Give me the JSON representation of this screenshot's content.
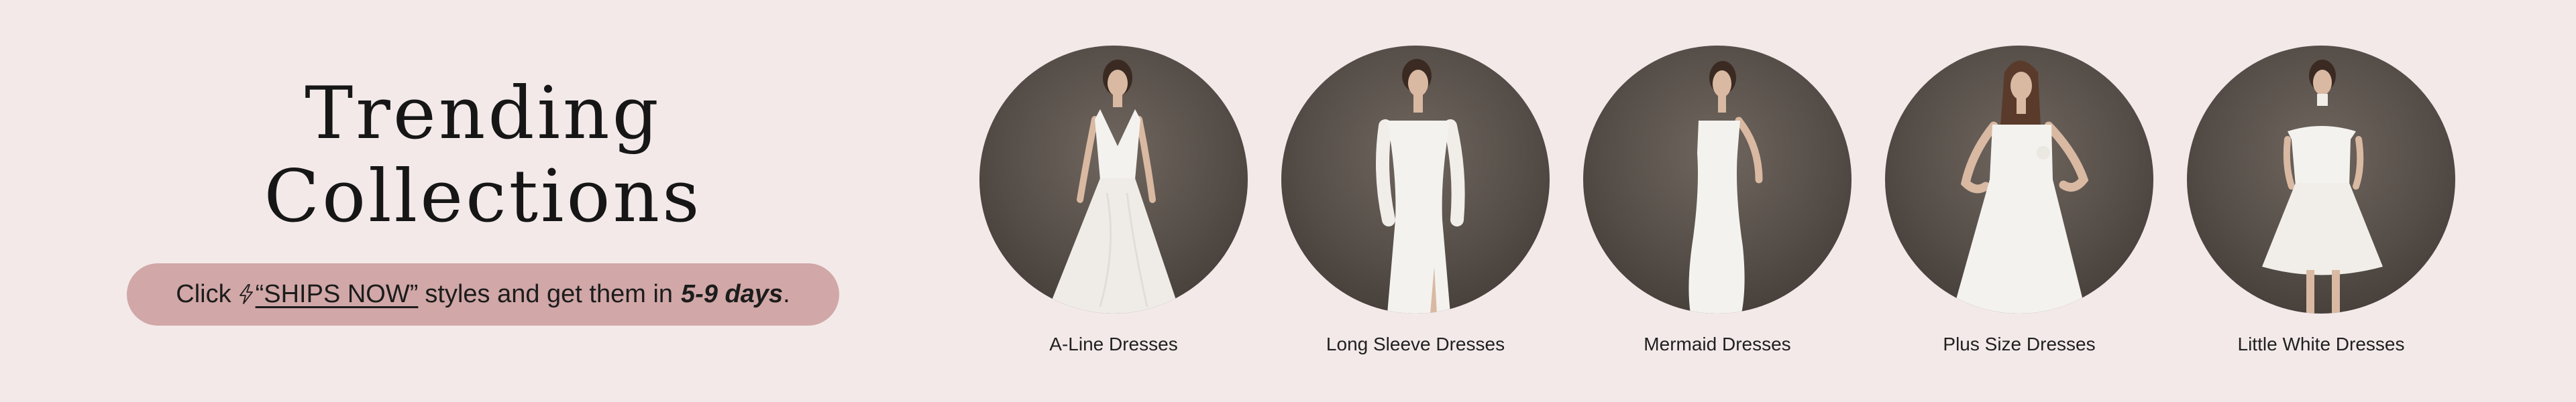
{
  "heading": {
    "line1": "Trending",
    "line2": "Collections"
  },
  "banner": {
    "prefix": "Click",
    "link_text": "“SHIPS NOW”",
    "middle": "styles and get them in",
    "days": "5-9 days",
    "suffix": "."
  },
  "collections": [
    {
      "label": "A-Line Dresses",
      "icon": "a-line-dress-photo"
    },
    {
      "label": "Long Sleeve Dresses",
      "icon": "long-sleeve-dress-photo"
    },
    {
      "label": "Mermaid Dresses",
      "icon": "mermaid-dress-photo"
    },
    {
      "label": "Plus Size  Dresses",
      "icon": "plus-size-dress-photo"
    },
    {
      "label": "Little White Dresses",
      "icon": "little-white-dress-photo"
    }
  ],
  "colors": {
    "background": "#f3e9e9",
    "banner": "#d1a7a7",
    "photo_backdrop": "#544c46",
    "dress": "#f4f2ef"
  }
}
